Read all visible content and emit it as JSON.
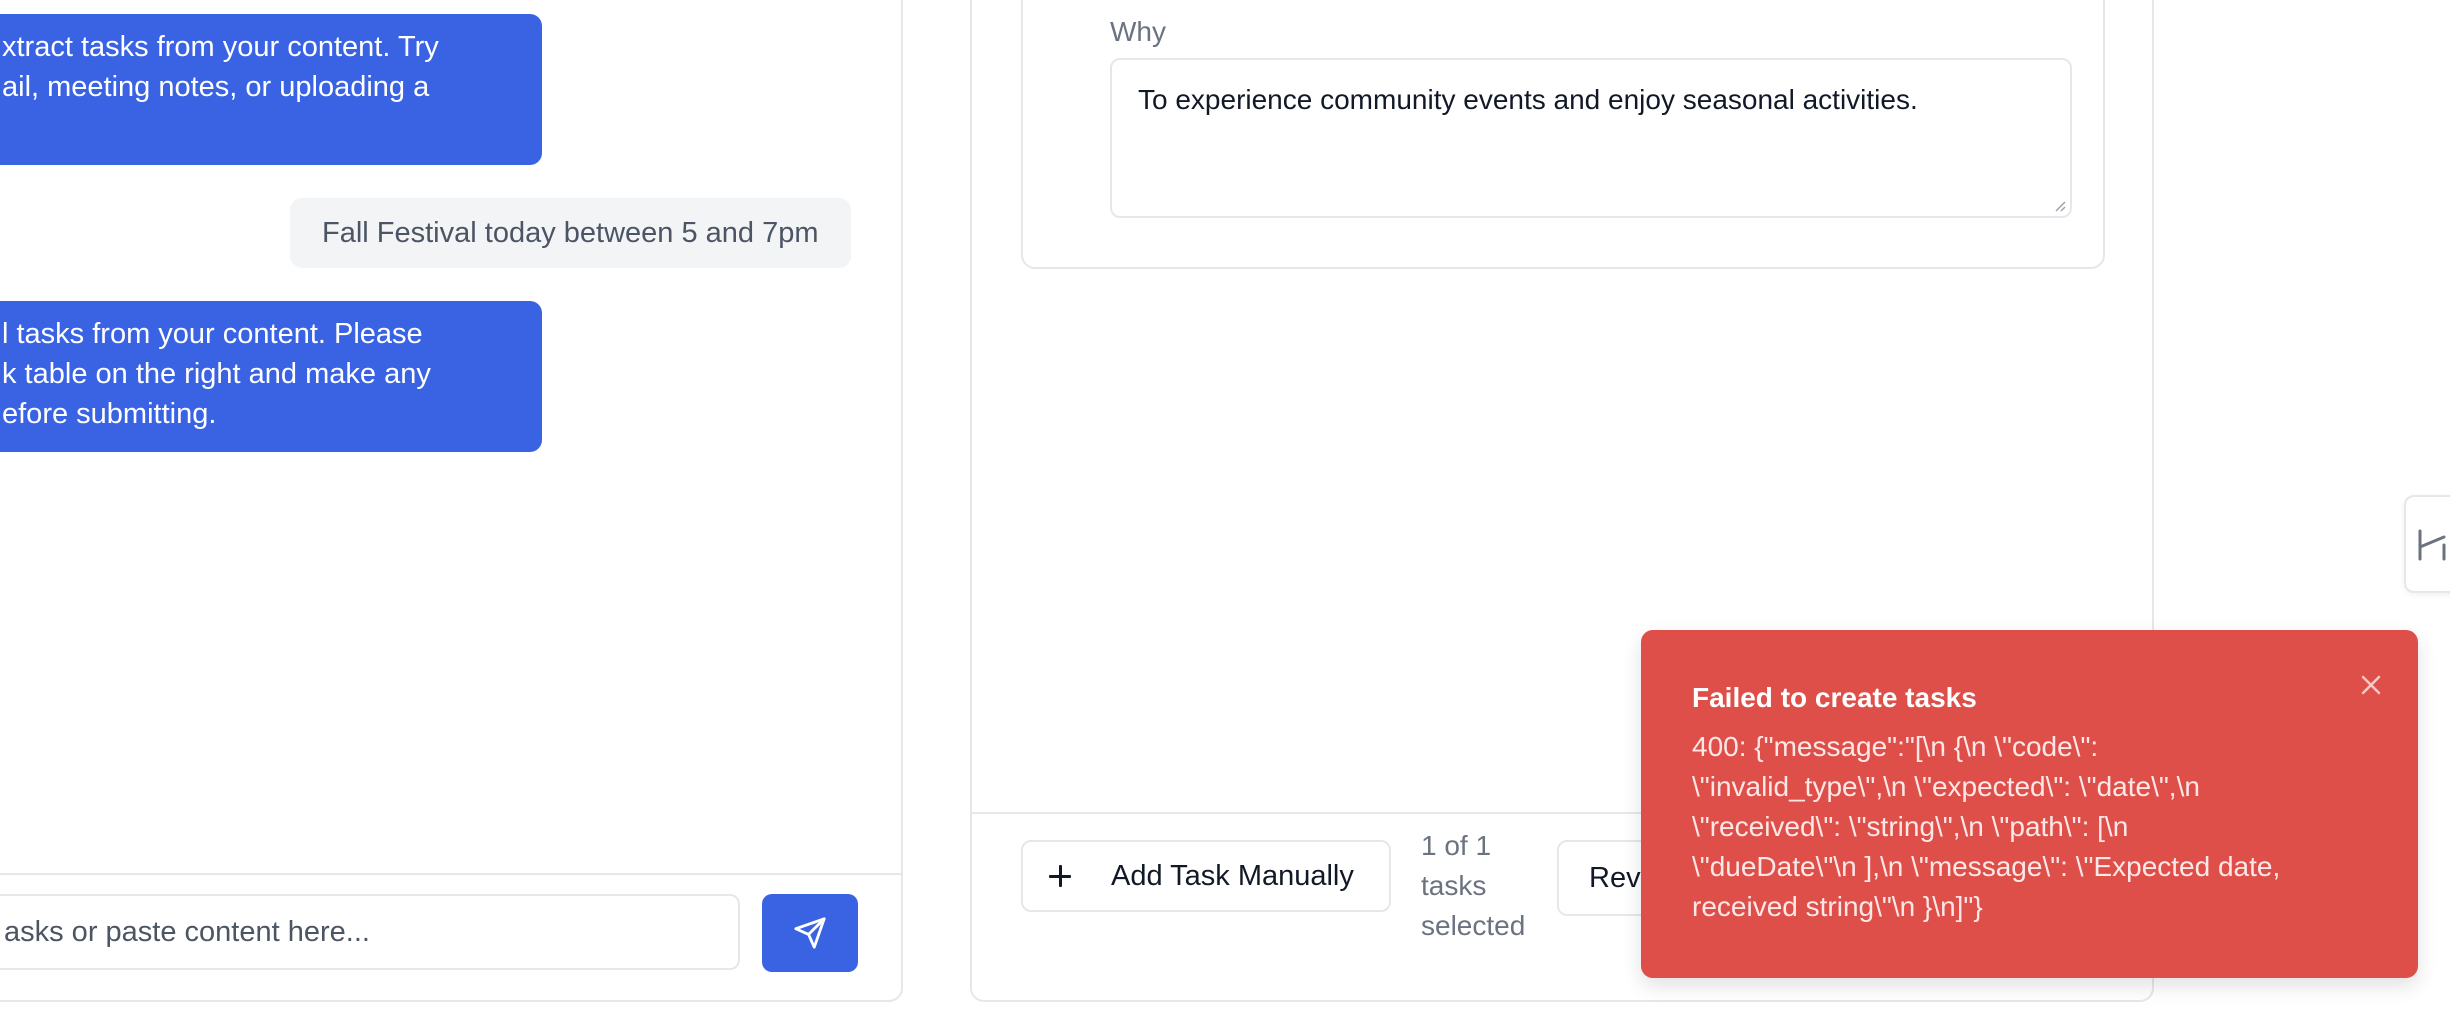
{
  "chat": {
    "messages": [
      {
        "role": "assistant",
        "lines": [
          "xtract tasks from your content. Try",
          "ail, meeting notes, or uploading a"
        ]
      },
      {
        "role": "user",
        "text": "Fall Festival today between 5 and 7pm"
      },
      {
        "role": "assistant",
        "lines": [
          "l tasks from your content. Please",
          "k table on the right and make any",
          "efore submitting."
        ]
      }
    ],
    "input_placeholder": "asks or paste content here...",
    "send_icon": "send-icon"
  },
  "task_card": {
    "why_label": "Why",
    "why_value": "To experience community events and enjoy seasonal activities."
  },
  "footer": {
    "add_task_label": "Add Task Manually",
    "selection_lines": [
      "1 of 1",
      "tasks",
      "selected"
    ],
    "review_label": "Revi"
  },
  "toast": {
    "title": "Failed to create tasks",
    "message_lines": [
      "400: {\"message\":\"[\\n {\\n \\\"code\\\":",
      "\\\"invalid_type\\\",\\n \\\"expected\\\": \\\"date\\\",\\n",
      "\\\"received\\\": \\\"string\\\",\\n \\\"path\\\": [\\n",
      "\\\"dueDate\\\"\\n ],\\n \\\"message\\\": \\\"Expected date,",
      "received string\\\"\\n }\\n]\"}"
    ],
    "background": "#df4f4a"
  },
  "colors": {
    "accent": "#3a63e4",
    "error": "#df4f4a"
  }
}
